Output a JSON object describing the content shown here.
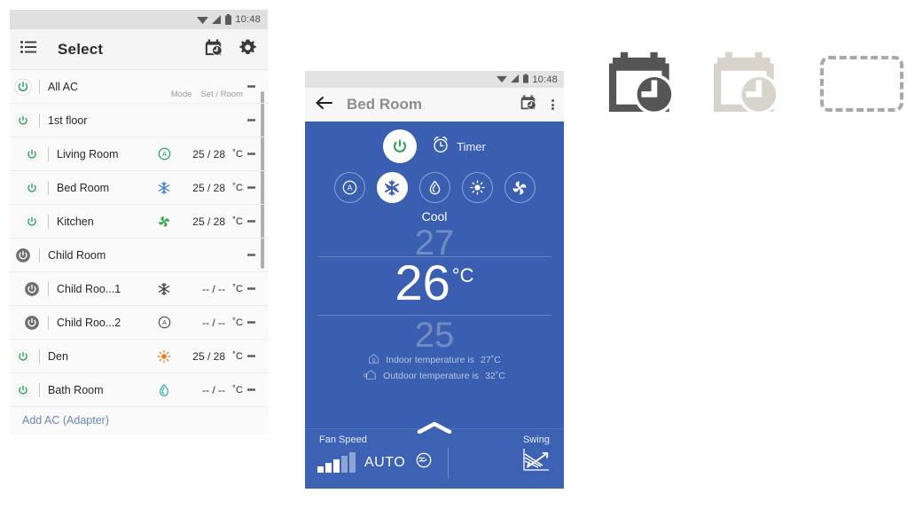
{
  "left_app": {
    "status_bar": {
      "time": "10:48",
      "icons": [
        "wifi-icon",
        "signal-icon",
        "battery-icon"
      ]
    },
    "appbar": {
      "menu_icon": "hamburger-list-icon",
      "title": "Select",
      "schedule_icon": "calendar-clock-icon",
      "settings_icon": "gear-icon"
    },
    "column_headers": {
      "mode": "Mode",
      "set_room": "Set / Room"
    },
    "rows": [
      {
        "name": "All AC",
        "power": "on-outline",
        "indent": 0,
        "mode_icon": "none",
        "temps": "",
        "unit": ""
      },
      {
        "name": "1st floor",
        "power": "on-outline",
        "indent": 0,
        "mode_icon": "none",
        "temps": "",
        "unit": ""
      },
      {
        "name": "Living Room",
        "power": "on",
        "indent": 1,
        "mode_icon": "auto-icon",
        "temps": "25 / 28",
        "unit": "˚C"
      },
      {
        "name": "Bed Room",
        "power": "on",
        "indent": 1,
        "mode_icon": "cool-icon",
        "temps": "25 / 28",
        "unit": "˚C"
      },
      {
        "name": "Kitchen",
        "power": "on",
        "indent": 1,
        "mode_icon": "fan-icon",
        "temps": "25 / 28",
        "unit": "˚C"
      },
      {
        "name": "Child Room",
        "power": "off-filled",
        "indent": 0,
        "mode_icon": "none",
        "temps": "",
        "unit": ""
      },
      {
        "name": "Child Roo...1",
        "power": "off-filled",
        "indent": 1,
        "mode_icon": "cool-icon",
        "temps": "-- / --",
        "unit": "˚C"
      },
      {
        "name": "Child Roo...2",
        "power": "off-filled",
        "indent": 1,
        "mode_icon": "auto-icon",
        "temps": "-- / --",
        "unit": "˚C"
      },
      {
        "name": "Den",
        "power": "on",
        "indent": 0,
        "mode_icon": "heat-icon",
        "temps": "25 / 28",
        "unit": "˚C"
      },
      {
        "name": "Bath Room",
        "power": "on",
        "indent": 0,
        "mode_icon": "dry-icon",
        "temps": "-- / --",
        "unit": "˚C"
      }
    ],
    "add_ac_label": "Add AC (Adapter)",
    "overflow_icon": "kebab-menu-icon"
  },
  "phone": {
    "status_bar": {
      "time": "10:48"
    },
    "appbar": {
      "back_icon": "back-arrow-icon",
      "title": "Bed Room",
      "schedule_icon": "calendar-clock-icon",
      "overflow_icon": "kebab-menu-icon"
    },
    "power_icon": "power-icon",
    "timer_label": "Timer",
    "timer_icon": "alarm-clock-icon",
    "modes": [
      {
        "icon": "auto-icon",
        "selected": false
      },
      {
        "icon": "cool-icon",
        "selected": true
      },
      {
        "icon": "dry-icon",
        "selected": false
      },
      {
        "icon": "heat-icon",
        "selected": false
      },
      {
        "icon": "fan-icon",
        "selected": false
      }
    ],
    "mode_name": "Cool",
    "temperature": {
      "above": "27",
      "current": "26",
      "unit": "°C",
      "below": "25"
    },
    "indoor": {
      "label": "Indoor temperature is",
      "value": "27˚C",
      "icon": "house-icon"
    },
    "outdoor": {
      "label": "Outdoor temperature is",
      "value": "32˚C",
      "icon": "house-outdoor-icon"
    },
    "bottom": {
      "fan_speed_label": "Fan Speed",
      "fan_auto_label": "AUTO",
      "fan_bars_icon": "fan-speed-bars-icon",
      "wind_icon": "wind-face-icon",
      "swing_label": "Swing",
      "swing_icon": "swing-arrows-icon",
      "handle_icon": "chevron-up-icon"
    }
  },
  "icon_set": {
    "items": [
      {
        "name": "calendar-clock-icon-dark",
        "color": "#555555"
      },
      {
        "name": "calendar-clock-icon-light",
        "color": "#d6d4cb"
      },
      {
        "name": "placeholder-dashed-box",
        "color": "#a8a8a8"
      }
    ]
  },
  "colors": {
    "accent_blue": "#3b5fb0",
    "power_green": "#2f9e5e",
    "cool_blue": "#3f7fd0",
    "heat_orange": "#f07c22",
    "dry_teal": "#2aa8a8",
    "fan_green": "#2fa83f",
    "link_blue": "#6787b7"
  }
}
